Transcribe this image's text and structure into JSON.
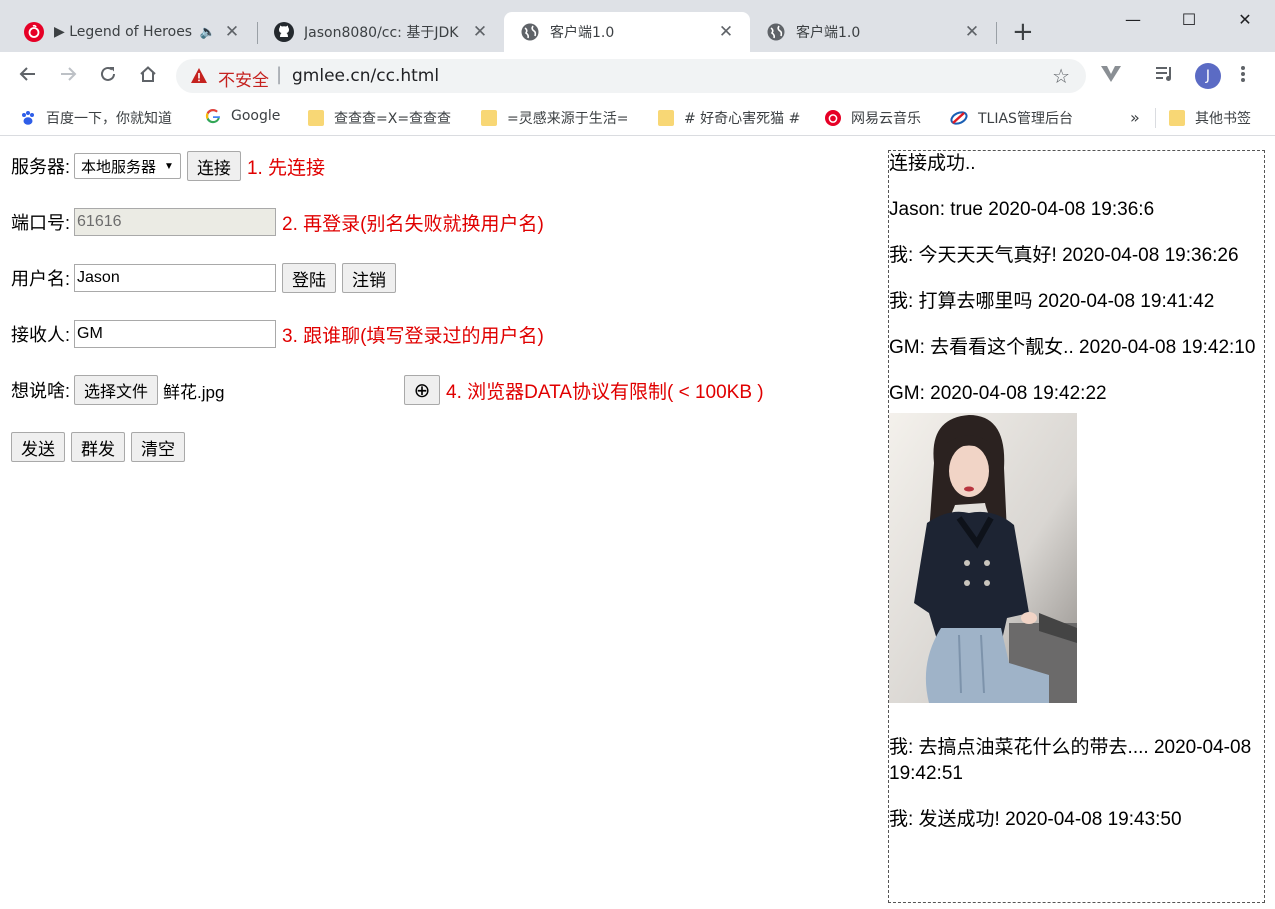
{
  "browser": {
    "tabs": [
      {
        "title": "▶ Legend of Heroes",
        "audio": true,
        "active": false
      },
      {
        "title": "Jason8080/cc: 基于JDK",
        "active": false
      },
      {
        "title": "客户端1.0",
        "active": true
      },
      {
        "title": "客户端1.0",
        "active": false
      }
    ],
    "new_tab": "+",
    "window_controls": {
      "minimize": "—",
      "maximize": "☐",
      "close": "✕"
    },
    "address": {
      "security_label": "不安全",
      "url": "gmlee.cn/cc.html"
    },
    "profile_initial": "J",
    "bookmarks": [
      {
        "label": "百度一下，你就知道",
        "icon": "baidu-paw-icon"
      },
      {
        "label": "Google",
        "icon": "google-g-icon"
      },
      {
        "label": "查查查=X=查查查",
        "icon": "folder-icon"
      },
      {
        "label": "=灵感来源于生活=",
        "icon": "folder-icon"
      },
      {
        "label": "# 好奇心害死猫 #",
        "icon": "folder-icon"
      },
      {
        "label": "网易云音乐",
        "icon": "netease-music-icon"
      },
      {
        "label": "TLIAS管理后台",
        "icon": "tlias-icon"
      }
    ],
    "more_bookmarks": "»",
    "other_bookmarks": "其他书签"
  },
  "form": {
    "server": {
      "label": "服务器:",
      "selected": "本地服务器",
      "connect_button": "连接",
      "hint": "1. 先连接"
    },
    "port": {
      "label": "端口号:",
      "value": "61616",
      "hint": "2. 再登录(别名失败就换用户名)"
    },
    "username": {
      "label": "用户名:",
      "value": "Jason",
      "login_button": "登陆",
      "logout_button": "注销"
    },
    "receiver": {
      "label": "接收人:",
      "value": "GM",
      "hint": "3. 跟谁聊(填写登录过的用户名)"
    },
    "message": {
      "label": "想说啥:",
      "file_button": "选择文件",
      "file_name": "鲜花.jpg",
      "add_symbol": "⊕",
      "hint": "4. 浏览器DATA协议有限制( < 100KB )"
    },
    "actions": {
      "send": "发送",
      "broadcast": "群发",
      "clear": "清空"
    }
  },
  "chat": {
    "messages": [
      "连接成功..",
      "Jason: true 2020-04-08 19:36:6",
      "我: 今天天天气真好! 2020-04-08 19:36:26",
      "我: 打算去哪里吗 2020-04-08 19:41:42",
      "GM: 去看看这个靓女.. 2020-04-08 19:42:10",
      "GM: 2020-04-08 19:42:22"
    ],
    "messages_after_image": [
      "我: 去搞点油菜花什么的带去.... 2020-04-08 19:42:51",
      "我: 发送成功! 2020-04-08 19:43:50"
    ]
  },
  "colors": {
    "hint": "#e00000",
    "insecure": "#c5221f",
    "tabstrip": "#dee1e6"
  }
}
